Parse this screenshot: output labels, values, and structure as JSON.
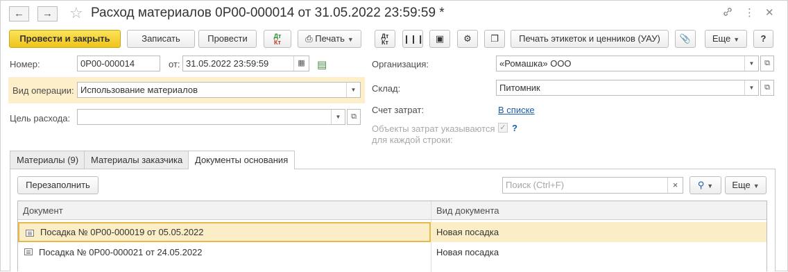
{
  "window": {
    "title": "Расход материалов 0Р00-000014 от 31.05.2022 23:59:59 *"
  },
  "toolbar": {
    "post_close": "Провести и закрыть",
    "save": "Записать",
    "post": "Провести",
    "dtkt_icon_text": "Дт Кт",
    "print": "Печать",
    "print_labels": "Печать этикеток и ценников (УАУ)",
    "more": "Еще",
    "help": "?"
  },
  "form": {
    "number_label": "Номер:",
    "number_value": "0Р00-000014",
    "from_label": "от:",
    "date_value": "31.05.2022 23:59:59",
    "op_label": "Вид операции:",
    "op_value": "Использование материалов",
    "purpose_label": "Цель расхода:",
    "purpose_value": "",
    "org_label": "Организация:",
    "org_value": "«Ромашка» ООО",
    "warehouse_label": "Склад:",
    "warehouse_value": "Питомник",
    "account_label": "Счет затрат:",
    "account_value": "В списке",
    "objects_label_1": "Объекты затрат указываются",
    "objects_label_2": "для каждой строки:",
    "objects_checked": true,
    "objects_help": "?"
  },
  "tabs": [
    {
      "label": "Материалы (9)"
    },
    {
      "label": "Материалы заказчика"
    },
    {
      "label": "Документы основания"
    }
  ],
  "panel": {
    "refill": "Перезаполнить",
    "search_placeholder": "Поиск (Ctrl+F)",
    "more": "Еще"
  },
  "table": {
    "columns": [
      "Документ",
      "Вид документа"
    ],
    "rows": [
      {
        "document": "Посадка № 0Р00-000019 от 05.05.2022",
        "type": "Новая посадка"
      },
      {
        "document": "Посадка № 0Р00-000021 от 24.05.2022",
        "type": "Новая посадка"
      }
    ]
  },
  "colors": {
    "primary_button": "#f0c419",
    "highlight": "#fcefc9",
    "link": "#1a5dab",
    "selected_row": "#fbeec7"
  }
}
